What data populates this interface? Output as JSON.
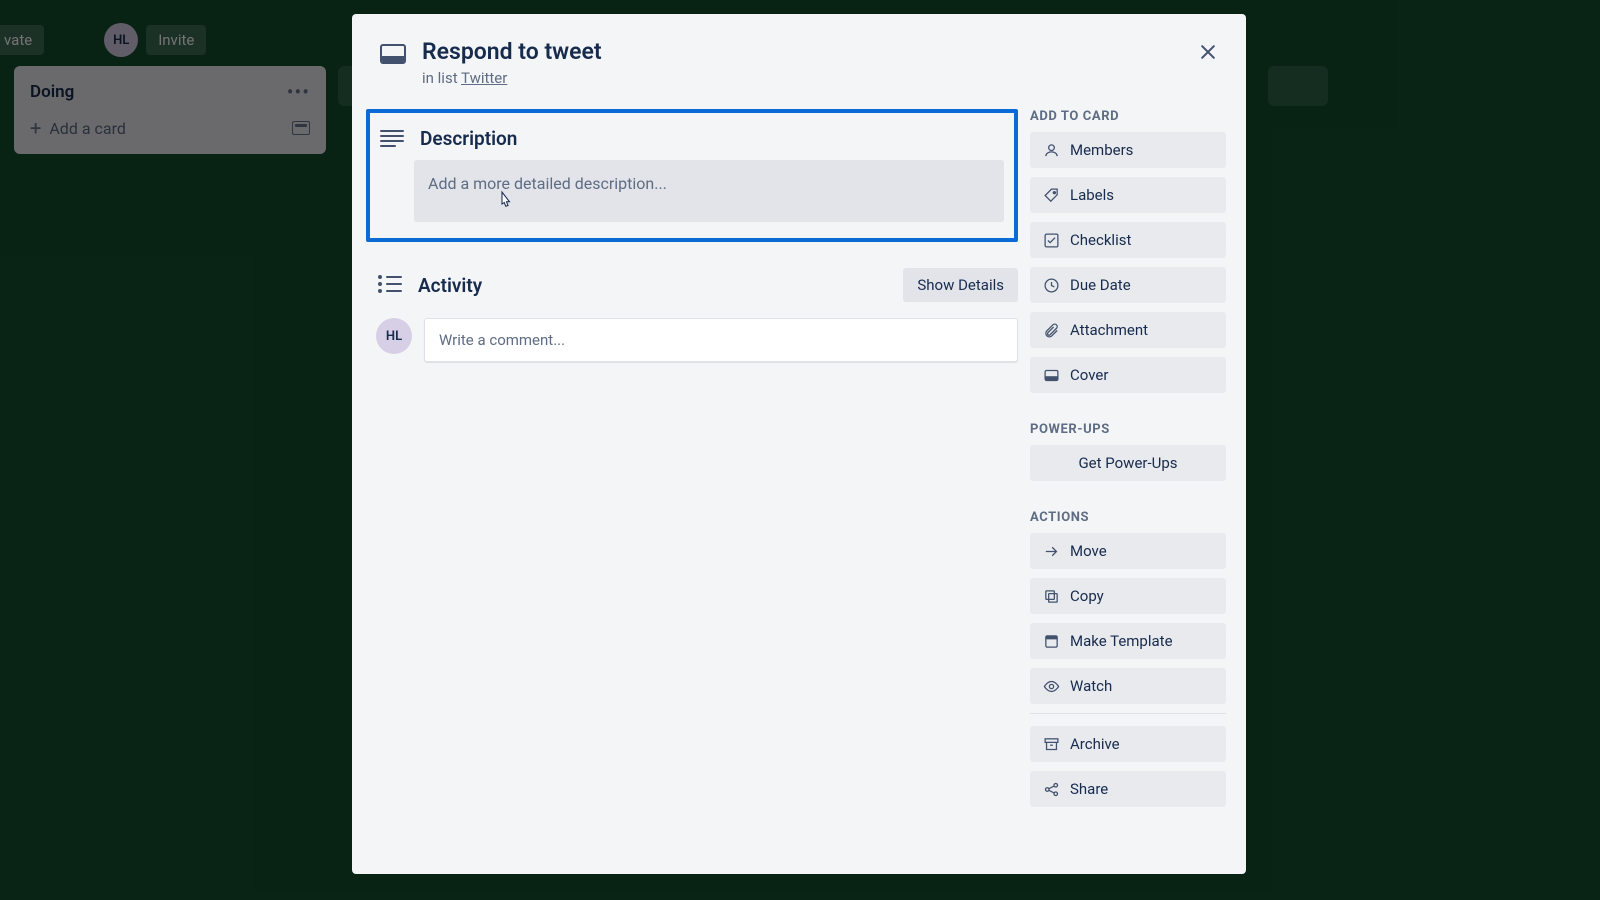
{
  "board": {
    "top_buttons": {
      "private": "vate",
      "invite": "Invite"
    },
    "avatar_initials": "HL",
    "list": {
      "title": "Doing",
      "add_card": "Add a card"
    }
  },
  "modal": {
    "title": "Respond to tweet",
    "in_list_prefix": "in list ",
    "in_list_link": "Twitter",
    "close_label": "Close",
    "description": {
      "heading": "Description",
      "placeholder": "Add a more detailed description..."
    },
    "activity": {
      "heading": "Activity",
      "show_details": "Show Details",
      "avatar_initials": "HL",
      "comment_placeholder": "Write a comment..."
    },
    "sidebar": {
      "add_to_card_heading": "ADD TO CARD",
      "add_to_card": [
        {
          "label": "Members",
          "icon": "members"
        },
        {
          "label": "Labels",
          "icon": "labels"
        },
        {
          "label": "Checklist",
          "icon": "checklist"
        },
        {
          "label": "Due Date",
          "icon": "duedate"
        },
        {
          "label": "Attachment",
          "icon": "attachment"
        },
        {
          "label": "Cover",
          "icon": "cover"
        }
      ],
      "powerups_heading": "POWER-UPS",
      "powerups_button": "Get Power-Ups",
      "actions_heading": "ACTIONS",
      "actions": [
        {
          "label": "Move",
          "icon": "move"
        },
        {
          "label": "Copy",
          "icon": "copy"
        },
        {
          "label": "Make Template",
          "icon": "template"
        },
        {
          "label": "Watch",
          "icon": "watch"
        },
        {
          "label": "Archive",
          "icon": "archive",
          "divider_before": true
        },
        {
          "label": "Share",
          "icon": "share"
        }
      ]
    }
  }
}
